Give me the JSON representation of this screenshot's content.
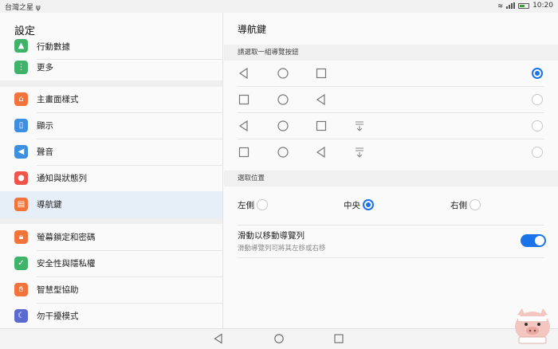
{
  "status": {
    "carrier": "台灣之星",
    "time": "10:20"
  },
  "left": {
    "title": "設定",
    "items": [
      {
        "label": "行動數據",
        "icon": "mobile-data-icon",
        "color": "#3fb36a"
      },
      {
        "label": "更多",
        "icon": "more-icon",
        "color": "#3fb36a"
      },
      {
        "label": "主畫面樣式",
        "icon": "home-icon",
        "color": "#f2743a"
      },
      {
        "label": "顯示",
        "icon": "display-icon",
        "color": "#3f8fe0"
      },
      {
        "label": "聲音",
        "icon": "sound-icon",
        "color": "#3f8fe0"
      },
      {
        "label": "通知與狀態列",
        "icon": "notification-icon",
        "color": "#f0534a"
      },
      {
        "label": "導航鍵",
        "icon": "navigation-key-icon",
        "color": "#f2743a"
      },
      {
        "label": "螢幕鎖定和密碼",
        "icon": "lock-icon",
        "color": "#f2743a"
      },
      {
        "label": "安全性與隱私權",
        "icon": "shield-icon",
        "color": "#3fb36a"
      },
      {
        "label": "智慧型協助",
        "icon": "hand-icon",
        "color": "#f2743a"
      },
      {
        "label": "勿干擾模式",
        "icon": "moon-icon",
        "color": "#5b6ad0"
      }
    ]
  },
  "right": {
    "title": "導航鍵",
    "section1": "請選取一組導覽按鈕",
    "section2": "選取位置",
    "positions": [
      "左側",
      "中央",
      "右側"
    ],
    "selected_position": "中央",
    "nav_sets": [
      [
        "back",
        "home",
        "recent"
      ],
      [
        "recent",
        "home",
        "back"
      ],
      [
        "back",
        "home",
        "recent",
        "notify"
      ],
      [
        "recent",
        "home",
        "back",
        "notify"
      ]
    ],
    "selected_set": 0,
    "toggle": {
      "title": "滑動以移動導覽列",
      "subtitle": "滑動導覽列可將其左移或右移",
      "on": true
    }
  },
  "colors": {
    "accent": "#1a73e8",
    "selected_bg": "#e6eef8"
  }
}
